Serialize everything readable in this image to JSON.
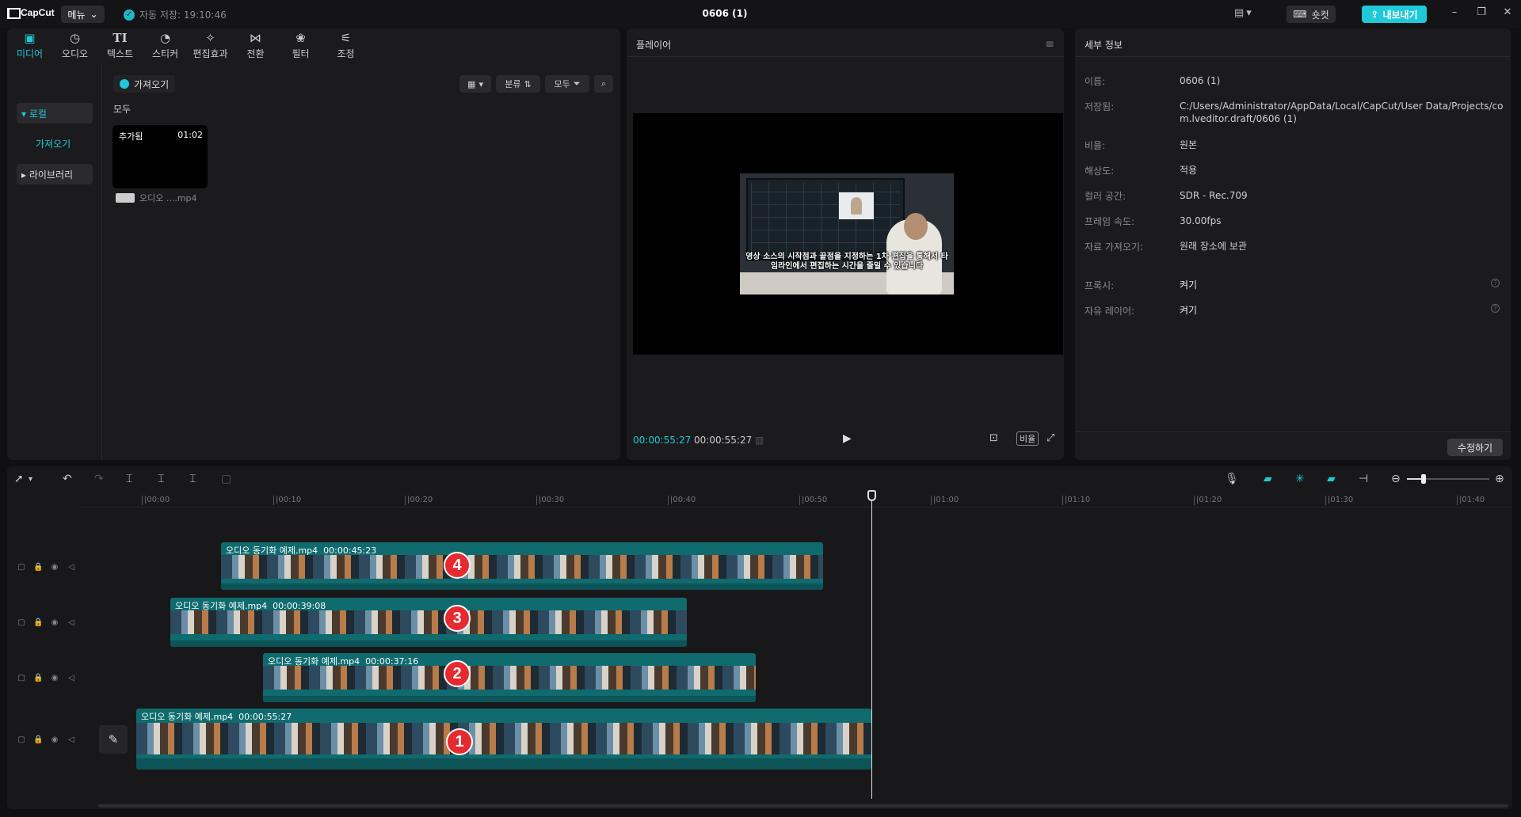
{
  "app": {
    "logo_text": "CapCut",
    "menu_label": "메뉴",
    "autosave_text": "자동 저장: 19:10:46",
    "window_title": "0606 (1)",
    "shortcut_label": "숏컷",
    "export_label": "내보내기"
  },
  "media": {
    "tabs": [
      {
        "label": "미디어",
        "icon": "media-icon"
      },
      {
        "label": "오디오",
        "icon": "audio-icon"
      },
      {
        "label": "텍스트",
        "icon": "text-icon"
      },
      {
        "label": "스티커",
        "icon": "sticker-icon"
      },
      {
        "label": "편집효과",
        "icon": "effects-icon"
      },
      {
        "label": "전환",
        "icon": "transition-icon"
      },
      {
        "label": "필터",
        "icon": "filter-icon"
      },
      {
        "label": "조정",
        "icon": "adjust-icon"
      }
    ],
    "sidebar": {
      "local": "▾ 로컬",
      "import": "가져오기",
      "library": "▸ 라이브러리"
    },
    "import_chip": "가져오기",
    "all_label": "모두",
    "sort_label": "분류",
    "filter_label": "모두",
    "card": {
      "added_label": "추가됨",
      "duration": "01:02",
      "filename": "오디오 ....mp4"
    }
  },
  "player": {
    "title": "플레이어",
    "subtitle": "영상 소스의 시작점과 끝점을 지정하는 1차 편집을 통해서 타임라인에서 편집하는 시간을 줄일 수 있습니다",
    "current_time": "00:00:55:27",
    "total_time": "00:00:55:27",
    "ratio_label": "비율"
  },
  "details": {
    "title": "세부 정보",
    "rows": [
      {
        "key": "이름:",
        "value": "0606 (1)"
      },
      {
        "key": "저장됨:",
        "value": "C:/Users/Administrator/AppData/Local/CapCut/User Data/Projects/com.lveditor.draft/0606 (1)"
      },
      {
        "key": "비율:",
        "value": "원본"
      },
      {
        "key": "해상도:",
        "value": "적용"
      },
      {
        "key": "컬러 공간:",
        "value": "SDR - Rec.709"
      },
      {
        "key": "프레임 속도:",
        "value": "30.00fps"
      },
      {
        "key": "자료 가져오기:",
        "value": "원래 장소에 보관"
      },
      {
        "key": "프록시:",
        "value": "켜기"
      },
      {
        "key": "자유 레이어:",
        "value": "켜기"
      }
    ],
    "modify_label": "수정하기"
  },
  "timeline": {
    "ruler_ticks": [
      "|00:00",
      "|00:10",
      "|00:20",
      "|00:30",
      "|00:40",
      "|00:50",
      "|01:00",
      "|01:10",
      "|01:20",
      "|01:30",
      "|01:40"
    ],
    "clips": [
      {
        "name": "오디오 동기화 예제.mp4",
        "duration": "00:00:45:23",
        "badge": "4"
      },
      {
        "name": "오디오 동기화 예제.mp4",
        "duration": "00:00:39:08",
        "badge": "3"
      },
      {
        "name": "오디오 동기화 예제.mp4",
        "duration": "00:00:37:16",
        "badge": "2"
      },
      {
        "name": "오디오 동기화 예제.mp4",
        "duration": "00:00:55:27",
        "badge": "1"
      }
    ]
  },
  "colors": {
    "accent": "#1fc9d8",
    "clip": "#0f6b6e",
    "badge": "#e62a2f"
  }
}
